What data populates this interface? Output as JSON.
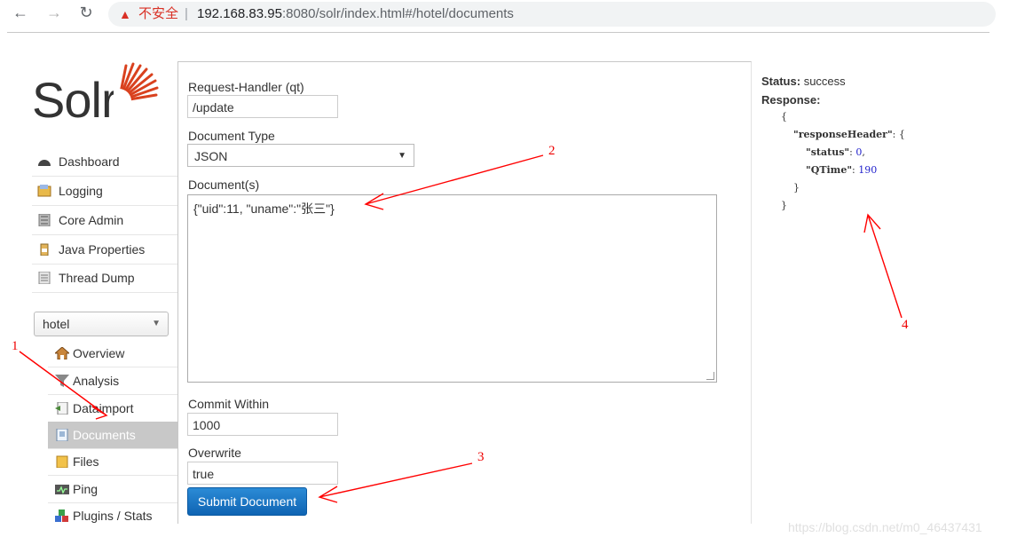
{
  "browser": {
    "back_icon": "arrow-left-icon",
    "forward_icon": "arrow-right-icon",
    "reload_icon": "reload-icon",
    "security_warning": "不安全",
    "separator": "|",
    "url_host": "192.168.83.95",
    "url_port": ":8080",
    "url_path": "/solr/index.html#/hotel/documents"
  },
  "logo": {
    "text": "Solr",
    "accent_color": "#d9411e"
  },
  "sidebar": {
    "items": [
      {
        "label": "Dashboard",
        "icon": "dashboard-icon"
      },
      {
        "label": "Logging",
        "icon": "logging-icon"
      },
      {
        "label": "Core Admin",
        "icon": "core-admin-icon"
      },
      {
        "label": "Java Properties",
        "icon": "java-icon"
      },
      {
        "label": "Thread Dump",
        "icon": "thread-dump-icon"
      }
    ],
    "core_selector": {
      "value": "hotel"
    },
    "core_items": [
      {
        "label": "Overview",
        "icon": "home-icon"
      },
      {
        "label": "Analysis",
        "icon": "funnel-icon"
      },
      {
        "label": "Dataimport",
        "icon": "dataimport-icon"
      },
      {
        "label": "Documents",
        "icon": "documents-icon",
        "active": true
      },
      {
        "label": "Files",
        "icon": "folder-icon"
      },
      {
        "label": "Ping",
        "icon": "ping-icon"
      },
      {
        "label": "Plugins / Stats",
        "icon": "plugins-icon"
      }
    ]
  },
  "form": {
    "request_handler_label": "Request-Handler (qt)",
    "request_handler_value": "/update",
    "doc_type_label": "Document Type",
    "doc_type_value": "JSON",
    "documents_label": "Document(s)",
    "documents_value": "{\"uid\":11, \"uname\":\"张三\"}",
    "commit_within_label": "Commit Within",
    "commit_within_value": "1000",
    "overwrite_label": "Overwrite",
    "overwrite_value": "true",
    "submit_label": "Submit Document",
    "submit_color": "#1a74c4"
  },
  "response": {
    "status_label": "Status:",
    "status_value": "success",
    "response_label": "Response:",
    "open_brace": "{",
    "header_key": "\"responseHeader\"",
    "header_open": ": {",
    "status_key": "\"status\"",
    "status_sep": ": ",
    "status_num": "0",
    "status_comma": ",",
    "qtime_key": "\"QTime\"",
    "qtime_sep": ": ",
    "qtime_num": "190",
    "inner_close": "}",
    "outer_close": "}"
  },
  "annotations": {
    "n1": "1",
    "n2": "2",
    "n3": "3",
    "n4": "4",
    "color": "#ff0000"
  },
  "watermark": "https://blog.csdn.net/m0_46437431"
}
